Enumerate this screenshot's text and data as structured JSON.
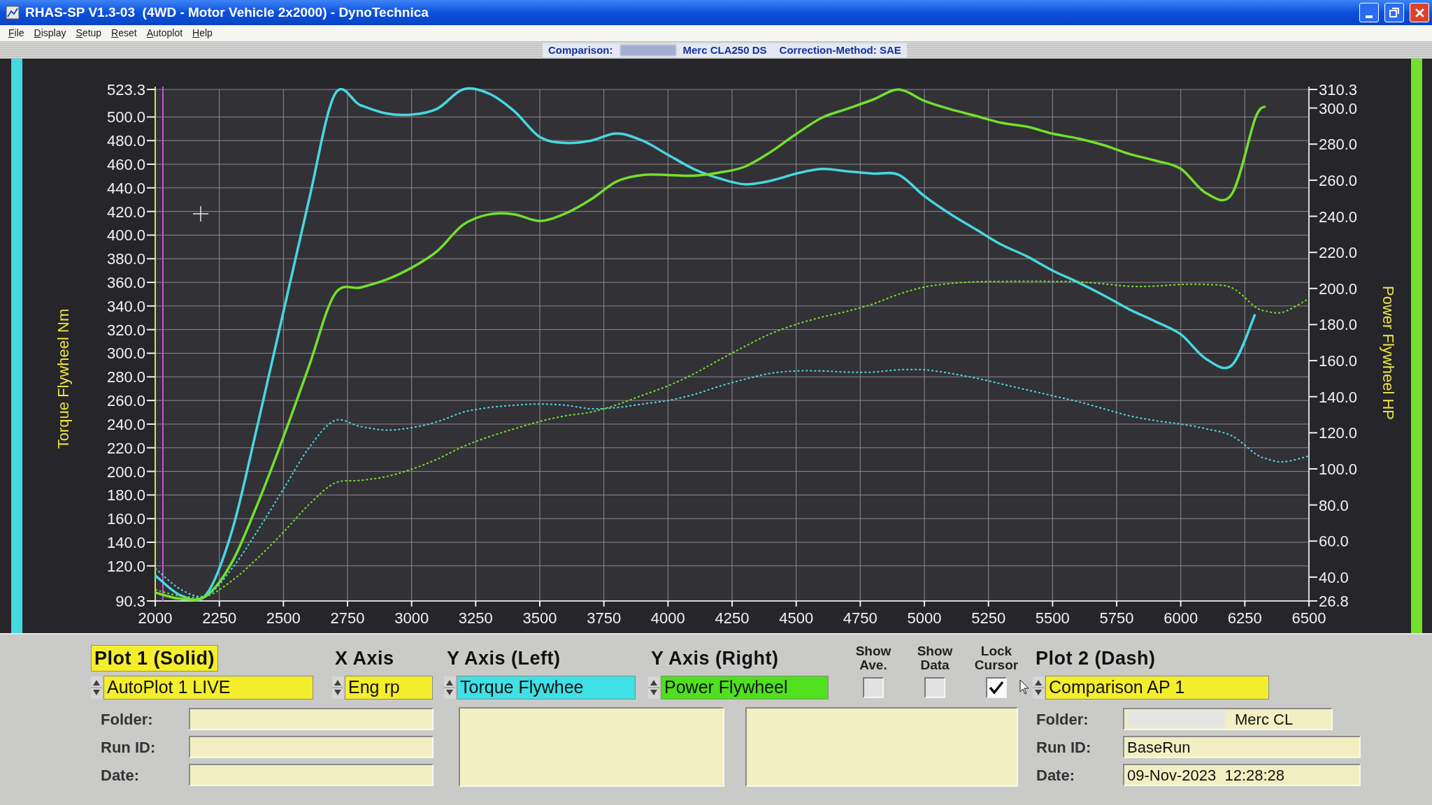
{
  "window": {
    "title": "RHAS-SP V1.3-03  (4WD - Motor Vehicle 2x2000) - DynoTechnica"
  },
  "menu": [
    "File",
    "Display",
    "Setup",
    "Reset",
    "Autoplot",
    "Help"
  ],
  "info_bar": {
    "comparison_label": "Comparison:",
    "redacted": true,
    "comparison_name": "Merc CLA250 DS",
    "correction": "Correction-Method: SAE"
  },
  "chart": {
    "chart_data": {
      "type": "line",
      "ylabel": "Torque Flywheel Nm",
      "y2label": "Power Flywheel HP",
      "grid": true,
      "x": [
        2000,
        2100,
        2200,
        2300,
        2400,
        2500,
        2600,
        2700,
        2800,
        2900,
        3000,
        3100,
        3200,
        3300,
        3400,
        3500,
        3600,
        3700,
        3800,
        3900,
        4000,
        4100,
        4200,
        4300,
        4400,
        4500,
        4600,
        4700,
        4800,
        4900,
        5000,
        5100,
        5200,
        5300,
        5400,
        5500,
        5600,
        5700,
        5800,
        5900,
        6000,
        6100,
        6200,
        6290,
        6330,
        6400,
        6500
      ],
      "xlim": [
        2000,
        6500
      ],
      "ylim": [
        90.3,
        523.3
      ],
      "y2lim": [
        26.8,
        310.3
      ],
      "xticks": [
        2000,
        2250,
        2500,
        2750,
        3000,
        3250,
        3500,
        3750,
        4000,
        4250,
        4500,
        4750,
        5000,
        5250,
        5500,
        5750,
        6000,
        6250,
        6500
      ],
      "yticks": [
        {
          "value": 90.3,
          "label": "90.3"
        },
        {
          "value": 120,
          "label": "120.0"
        },
        {
          "value": 140,
          "label": "140.0"
        },
        {
          "value": 160,
          "label": "160.0"
        },
        {
          "value": 180,
          "label": "180.0"
        },
        {
          "value": 200,
          "label": "200.0"
        },
        {
          "value": 220,
          "label": "220.0"
        },
        {
          "value": 240,
          "label": "240.0"
        },
        {
          "value": 260,
          "label": "260.0"
        },
        {
          "value": 280,
          "label": "280.0"
        },
        {
          "value": 300,
          "label": "300.0"
        },
        {
          "value": 320,
          "label": "320.0"
        },
        {
          "value": 340,
          "label": "340.0"
        },
        {
          "value": 360,
          "label": "360.0"
        },
        {
          "value": 380,
          "label": "380.0"
        },
        {
          "value": 400,
          "label": "400.0"
        },
        {
          "value": 420,
          "label": "420.0"
        },
        {
          "value": 440,
          "label": "440.0"
        },
        {
          "value": 460,
          "label": "460.0"
        },
        {
          "value": 480,
          "label": "480.0"
        },
        {
          "value": 500,
          "label": "500.0"
        },
        {
          "value": 523.3,
          "label": "523.3"
        }
      ],
      "y2ticks": [
        {
          "value": 26.8,
          "label": "26.8"
        },
        {
          "value": 40,
          "label": "40.0"
        },
        {
          "value": 60,
          "label": "60.0"
        },
        {
          "value": 80,
          "label": "80.0"
        },
        {
          "value": 100,
          "label": "100.0"
        },
        {
          "value": 120,
          "label": "120.0"
        },
        {
          "value": 140,
          "label": "140.0"
        },
        {
          "value": 160,
          "label": "160.0"
        },
        {
          "value": 180,
          "label": "180.0"
        },
        {
          "value": 200,
          "label": "200.0"
        },
        {
          "value": 220,
          "label": "220.0"
        },
        {
          "value": 240,
          "label": "240.0"
        },
        {
          "value": 260,
          "label": "260.0"
        },
        {
          "value": 280,
          "label": "280.0"
        },
        {
          "value": 300,
          "label": "300.0"
        },
        {
          "value": 310.3,
          "label": "310.3"
        }
      ],
      "ref_lines": [
        {
          "axis": "x",
          "value": 2030,
          "color": "#c455d6"
        }
      ],
      "series": [
        {
          "color": "#46d8e0",
          "line_style": "solid",
          "values": [
            112,
            95,
            96,
            150,
            240,
            335,
            430,
            519,
            510,
            503,
            502,
            507,
            523.3,
            520,
            505,
            483,
            478,
            480,
            486,
            480,
            468,
            456,
            448,
            443,
            446,
            452,
            456,
            454,
            452,
            451,
            433,
            418,
            405,
            392,
            382,
            370,
            360,
            349,
            337,
            327,
            316,
            295,
            290,
            333,
            null,
            null,
            null
          ]
        },
        {
          "color": "#72e02c",
          "axis": "y2",
          "line_style": "solid",
          "values": [
            31.5,
            28.0,
            29.7,
            48.4,
            80.9,
            117.6,
            157.0,
            196.8,
            200.5,
            204.8,
            211.5,
            220.7,
            235.2,
            241.0,
            241.1,
            237.4,
            241.6,
            249.4,
            259.3,
            262.9,
            262.9,
            262.5,
            264.2,
            267.5,
            275.6,
            285.6,
            294.6,
            299.6,
            304.7,
            310.3,
            304.0,
            299.4,
            295.7,
            291.8,
            289.7,
            285.8,
            283.1,
            279.4,
            274.5,
            270.9,
            266.3,
            252.7,
            252.5,
            294.1,
            301.0,
            null,
            null
          ]
        },
        {
          "color": "#46d8e0",
          "line_style": "dash",
          "values": [
            118,
            100,
            95,
            118,
            150,
            185,
            220,
            243,
            238,
            235,
            237,
            242,
            250,
            254,
            256,
            257,
            256,
            253,
            254,
            257,
            260,
            265,
            272,
            278,
            283,
            285,
            285,
            284,
            284,
            286,
            286,
            283,
            279,
            274,
            269,
            264,
            259,
            253,
            247,
            243,
            240,
            236,
            230,
            215,
            211,
            208,
            213
          ]
        },
        {
          "color": "#72e02c",
          "axis": "y2",
          "line_style": "dash",
          "values": [
            33.1,
            29.5,
            29.4,
            38.1,
            50.6,
            64.9,
            80.3,
            92.1,
            93.6,
            95.7,
            99.8,
            105.4,
            112.3,
            117.7,
            122.2,
            126.3,
            129.4,
            131.5,
            135.5,
            140.8,
            146.0,
            152.6,
            160.4,
            167.9,
            174.9,
            180.1,
            184.1,
            187.4,
            191.4,
            196.8,
            200.8,
            202.7,
            203.7,
            203.9,
            204.0,
            203.9,
            203.7,
            202.5,
            201.2,
            201.3,
            202.2,
            202.2,
            200.3,
            189.9,
            187.5,
            186.9,
            194.4
          ]
        }
      ]
    }
  },
  "plot_1": {
    "heading": "Plot 1 (Solid)",
    "selected": true,
    "source": "AutoPlot 1 LIVE",
    "fields": [
      {
        "label": "Folder:"
      },
      {
        "label": "Run ID:"
      },
      {
        "label": "Date:"
      }
    ]
  },
  "axes": [
    {
      "heading": "X Axis",
      "channel": "Eng rp",
      "color": "#f4ee2c"
    },
    {
      "heading": "Y Axis (Left)",
      "channel": "Torque Flywhee",
      "color": "#3fe0e6"
    },
    {
      "heading": "Y Axis (Right)",
      "channel": "Power Flywheel",
      "color": "#4fe01e"
    }
  ],
  "checkboxes": [
    {
      "label": "Show Ave.",
      "checked": false
    },
    {
      "label": "Show Data",
      "checked": false
    },
    {
      "label": "Lock Cursor",
      "checked": true
    }
  ],
  "plot_2": {
    "heading": "Plot 2 (Dash)",
    "selected": false,
    "source": "Comparison AP 1",
    "fields": [
      {
        "label": "Folder:",
        "value": "Merc CL",
        "redacted": true
      },
      {
        "label": "Run ID:",
        "value": "BaseRun",
        "redacted": false
      },
      {
        "label": "Date:",
        "value": "09-Nov-2023  12:28:28",
        "redacted": false
      }
    ]
  }
}
